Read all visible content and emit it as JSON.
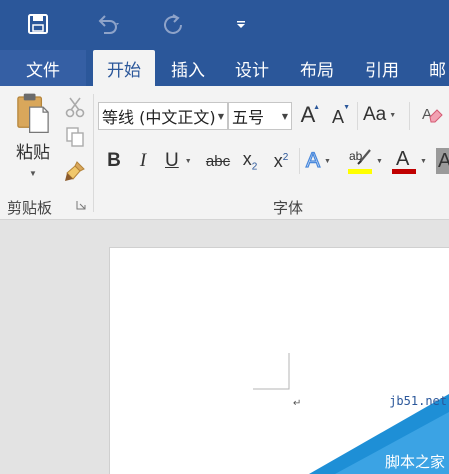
{
  "titlebar": {
    "icons": [
      "save-icon",
      "undo-icon",
      "redo-icon",
      "customize-qat-icon"
    ],
    "bg": "#2b579a"
  },
  "tabs": {
    "file": "文件",
    "home": "开始",
    "insert": "插入",
    "design": "设计",
    "layout": "布局",
    "references": "引用",
    "mailings": "邮"
  },
  "clipboard": {
    "paste": "粘贴",
    "label": "剪贴板",
    "icons": [
      "paste-icon",
      "cut-icon",
      "copy-icon",
      "format-painter-icon",
      "dialog-launcher-icon"
    ]
  },
  "font": {
    "font_name": "等线 (中文正文)",
    "font_size": "五号",
    "label": "字体",
    "grow": "A",
    "shrink": "A",
    "change_case": "Aa",
    "bold": "B",
    "italic": "I",
    "underline": "U",
    "strike": "abc",
    "subscript_base": "x",
    "subscript_sub": "2",
    "superscript_base": "x",
    "superscript_sup": "2",
    "text_effects": "A",
    "highlight": "ab",
    "font_color": "A",
    "char_shading": "A",
    "highlight_color": "#ffff00",
    "font_color_value": "#c00000"
  },
  "watermark": {
    "text": "jb51.net",
    "subtext": "脚本之家"
  }
}
